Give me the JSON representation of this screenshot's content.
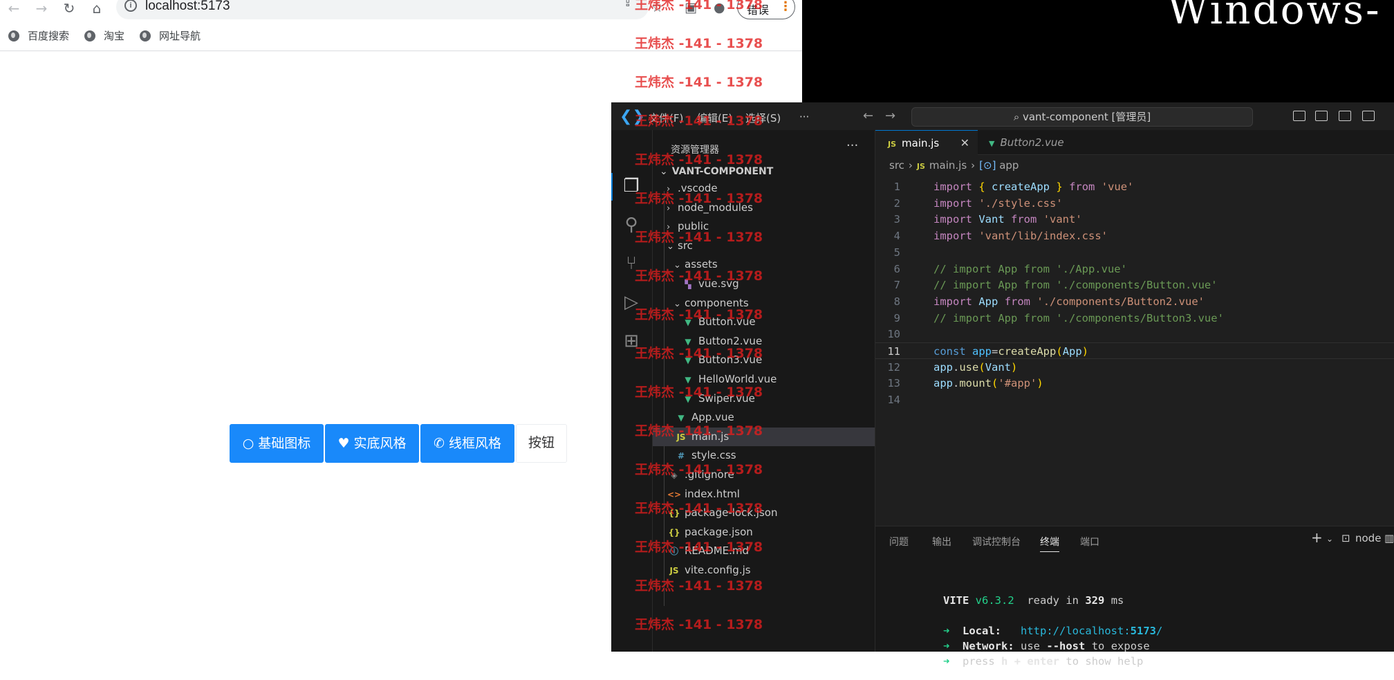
{
  "browser": {
    "url": "localhost:5173",
    "error_label": "错误",
    "more_icon": "⋮",
    "bookmarks": [
      "百度搜索",
      "淘宝",
      "网址导航"
    ]
  },
  "page": {
    "buttons": [
      {
        "icon": "circle-outline-icon",
        "label": "基础图标"
      },
      {
        "icon": "heart-fill-icon",
        "label": "实底风格"
      },
      {
        "icon": "phone-outline-icon",
        "label": "线框风格"
      },
      {
        "icon": "",
        "label": "按钮"
      }
    ]
  },
  "desktop": {
    "windows_text": "Windows-"
  },
  "vscode": {
    "menu": [
      "文件(F)",
      "编辑(E)",
      "选择(S)"
    ],
    "menu_more": "···",
    "command_center": "vant-component [管理员]",
    "sidebar_title": "资源管理器",
    "sidebar_more": "···",
    "project": "VANT-COMPONENT",
    "tree": [
      {
        "label": ".vscode",
        "kind": "folder",
        "open": false,
        "depth": 1
      },
      {
        "label": "node_modules",
        "kind": "folder",
        "open": false,
        "depth": 1
      },
      {
        "label": "public",
        "kind": "folder",
        "open": false,
        "depth": 1
      },
      {
        "label": "src",
        "kind": "folder",
        "open": true,
        "depth": 1
      },
      {
        "label": "assets",
        "kind": "folder",
        "open": true,
        "depth": 2
      },
      {
        "label": "vue.svg",
        "kind": "svg",
        "depth": 3
      },
      {
        "label": "components",
        "kind": "folder",
        "open": true,
        "depth": 2
      },
      {
        "label": "Button.vue",
        "kind": "vue",
        "depth": 3
      },
      {
        "label": "Button2.vue",
        "kind": "vue",
        "depth": 3
      },
      {
        "label": "Button3.vue",
        "kind": "vue",
        "depth": 3
      },
      {
        "label": "HelloWorld.vue",
        "kind": "vue",
        "depth": 3
      },
      {
        "label": "Swiper.vue",
        "kind": "vue",
        "depth": 3
      },
      {
        "label": "App.vue",
        "kind": "vue",
        "depth": 2
      },
      {
        "label": "main.js",
        "kind": "js",
        "depth": 2,
        "selected": true
      },
      {
        "label": "style.css",
        "kind": "css",
        "depth": 2
      },
      {
        "label": ".gitignore",
        "kind": "git",
        "depth": 1
      },
      {
        "label": "index.html",
        "kind": "html",
        "depth": 1
      },
      {
        "label": "package-lock.json",
        "kind": "json",
        "depth": 1
      },
      {
        "label": "package.json",
        "kind": "json",
        "depth": 1
      },
      {
        "label": "README.md",
        "kind": "md",
        "depth": 1
      },
      {
        "label": "vite.config.js",
        "kind": "js",
        "depth": 1
      }
    ],
    "tabs": [
      {
        "label": "main.js",
        "kind": "js",
        "active": true
      },
      {
        "label": "Button2.vue",
        "kind": "vue",
        "active": false
      }
    ],
    "breadcrumb": [
      "src",
      "main.js",
      "app"
    ],
    "current_line": 11,
    "code": [
      [
        [
          "kw2",
          "import"
        ],
        [
          "",
          " "
        ],
        [
          "br1",
          "{"
        ],
        [
          "",
          " "
        ],
        [
          "id",
          "createApp"
        ],
        [
          "",
          " "
        ],
        [
          "br1",
          "}"
        ],
        [
          "",
          " "
        ],
        [
          "kw2",
          "from"
        ],
        [
          "",
          " "
        ],
        [
          "str",
          "'vue'"
        ]
      ],
      [
        [
          "kw2",
          "import"
        ],
        [
          "",
          " "
        ],
        [
          "str",
          "'./style.css'"
        ]
      ],
      [
        [
          "kw2",
          "import"
        ],
        [
          "",
          " "
        ],
        [
          "id",
          "Vant"
        ],
        [
          "",
          " "
        ],
        [
          "kw2",
          "from"
        ],
        [
          "",
          " "
        ],
        [
          "str",
          "'vant'"
        ]
      ],
      [
        [
          "kw2",
          "import"
        ],
        [
          "",
          " "
        ],
        [
          "str",
          "'vant/lib/index.css'"
        ]
      ],
      [],
      [
        [
          "com",
          "// import App from './App.vue'"
        ]
      ],
      [
        [
          "com",
          "// import App from './components/Button.vue'"
        ]
      ],
      [
        [
          "kw2",
          "import"
        ],
        [
          "",
          " "
        ],
        [
          "id",
          "App"
        ],
        [
          "",
          " "
        ],
        [
          "kw2",
          "from"
        ],
        [
          "",
          " "
        ],
        [
          "str",
          "'./components/Button2.vue'"
        ]
      ],
      [
        [
          "com",
          "// import App from './components/Button3.vue'"
        ]
      ],
      [],
      [
        [
          "kw",
          "const"
        ],
        [
          "",
          " "
        ],
        [
          "cid",
          "app"
        ],
        [
          "",
          "="
        ],
        [
          "fn",
          "createApp"
        ],
        [
          "br1",
          "("
        ],
        [
          "id",
          "App"
        ],
        [
          "br1",
          ")"
        ]
      ],
      [
        [
          "id",
          "app"
        ],
        [
          "",
          "."
        ],
        [
          "fn",
          "use"
        ],
        [
          "br1",
          "("
        ],
        [
          "id",
          "Vant"
        ],
        [
          "br1",
          ")"
        ]
      ],
      [
        [
          "id",
          "app"
        ],
        [
          "",
          "."
        ],
        [
          "fn",
          "mount"
        ],
        [
          "br1",
          "("
        ],
        [
          "str",
          "'#app'"
        ],
        [
          "br1",
          ")"
        ]
      ],
      []
    ],
    "panel_tabs": [
      "问题",
      "输出",
      "调试控制台",
      "终端",
      "端口"
    ],
    "active_panel_tab": "终端",
    "terminal_name": "node",
    "terminal": {
      "vite_name": "VITE",
      "vite_version": "v6.3.2",
      "ready_text": "ready in",
      "ready_ms": "329",
      "ready_unit": "ms",
      "local_label": "Local:",
      "local_url_prefix": "http://localhost:",
      "local_url_port": "5173",
      "local_url_suffix": "/",
      "network_label": "Network:",
      "network_text_1": "use",
      "network_flag": "--host",
      "network_text_2": "to expose",
      "help_text_1": "press",
      "help_key": "h + enter",
      "help_text_2": "to show help"
    }
  },
  "watermark": {
    "text": "王炜杰 -141 - 1378",
    "color": "#e11e1e"
  }
}
